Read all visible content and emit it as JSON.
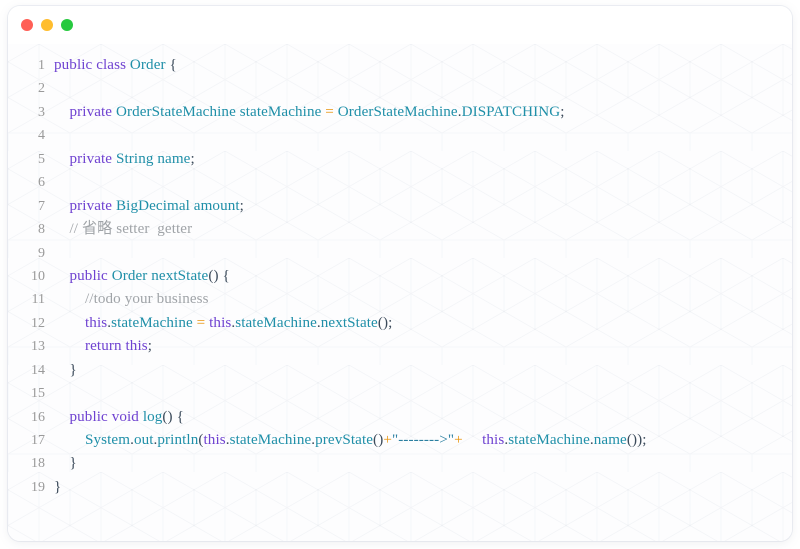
{
  "window": {
    "controls": [
      {
        "name": "close",
        "color": "#ff5f56"
      },
      {
        "name": "minimize",
        "color": "#ffbd2e"
      },
      {
        "name": "maximize",
        "color": "#27c93f"
      }
    ]
  },
  "editor": {
    "language": "java",
    "background": "#fdfdfe",
    "line_number_color": "#9a9a9a",
    "colors": {
      "keyword": "#6f42d1",
      "type": "#1f8fa8",
      "operator": "#e8940c",
      "comment": "#a0a4a8",
      "string": "#2a7fa0",
      "plain": "#3b4a5a"
    },
    "lines": [
      {
        "num": "1",
        "text": "public class Order {"
      },
      {
        "num": "2",
        "text": ""
      },
      {
        "num": "3",
        "text": "    private OrderStateMachine stateMachine = OrderStateMachine.DISPATCHING;"
      },
      {
        "num": "4",
        "text": ""
      },
      {
        "num": "5",
        "text": "    private String name;"
      },
      {
        "num": "6",
        "text": ""
      },
      {
        "num": "7",
        "text": "    private BigDecimal amount;"
      },
      {
        "num": "8",
        "text": "    // 省略 setter  getter"
      },
      {
        "num": "9",
        "text": ""
      },
      {
        "num": "10",
        "text": "    public Order nextState() {"
      },
      {
        "num": "11",
        "text": "        //todo your business"
      },
      {
        "num": "12",
        "text": "        this.stateMachine = this.stateMachine.nextState();"
      },
      {
        "num": "13",
        "text": "        return this;"
      },
      {
        "num": "14",
        "text": "    }"
      },
      {
        "num": "15",
        "text": ""
      },
      {
        "num": "16",
        "text": "    public void log() {"
      },
      {
        "num": "17",
        "text": "        System.out.println(this.stateMachine.prevState()+\"-------->\"+     this.stateMachine.name());"
      },
      {
        "num": "18",
        "text": "    }"
      },
      {
        "num": "19",
        "text": "}"
      }
    ]
  }
}
